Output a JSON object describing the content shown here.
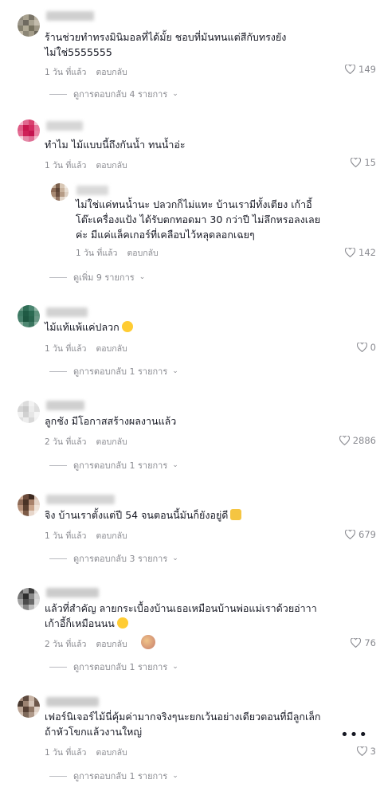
{
  "comments": [
    {
      "text": "ร้านช่วยทำทรงมินิมอลที่ได้มั้ย ชอบที่มันทนแต่สีกับทรงยัง\nไม่ใช่5555555",
      "time": "1 วัน ที่แล้ว",
      "reply_label": "ตอบกลับ",
      "likes": "149",
      "view_replies": "ดูการตอบกลับ 4 รายการ"
    },
    {
      "text": "ทำไม ไม้แบบนี้ถึงกันน้ำ ทนน้ำอ่ะ",
      "time": "1 วัน ที่แล้ว",
      "reply_label": "ตอบกลับ",
      "likes": "15",
      "reply": {
        "text": "ไม่ใช่แค่ทนน้ำนะ ปลวกก็ไม่แทะ บ้านเรามีทั้งเตียง เก้าอี้\nโต๊ะเครื่องแป้ง ได้รับตกทอดมา 30 กว่าปี ไม่ลึกหรอลงเลย\nค่ะ มีแค่แล็คเกอร์ที่เคลือบไว้หลุดลอกเฉยๆ",
        "time": "1 วัน ที่แล้ว",
        "reply_label": "ตอบกลับ",
        "likes": "142"
      },
      "view_replies": "ดูเพิ่ม 9 รายการ"
    },
    {
      "text": "ไม้แท้แพ้แค่ปลวก",
      "time": "1 วัน ที่แล้ว",
      "reply_label": "ตอบกลับ",
      "likes": "0",
      "view_replies": "ดูการตอบกลับ 1 รายการ"
    },
    {
      "text": "ลูกชัง มีโอกาสสร้างผลงานแล้ว",
      "time": "2 วัน ที่แล้ว",
      "reply_label": "ตอบกลับ",
      "likes": "2886",
      "view_replies": "ดูการตอบกลับ 1 รายการ"
    },
    {
      "text": "จิง บ้านเราตั้งแต่ปี 54 จนตอนนี้มันก็ยังอยู่ดี",
      "time": "1 วัน ที่แล้ว",
      "reply_label": "ตอบกลับ",
      "likes": "679",
      "view_replies": "ดูการตอบกลับ 3 รายการ"
    },
    {
      "text": "แล้วที่สำคัญ ลายกระเบื้องบ้านเธอเหมือนบ้านพ่อแม่เราด้วยอ่าาา\nเก้าอี้ก็เหมือนนน",
      "time": "2 วัน ที่แล้ว",
      "reply_label": "ตอบกลับ",
      "likes": "76",
      "view_replies": "ดูการตอบกลับ 1 รายการ"
    },
    {
      "text": "เฟอร์นิเจอร์ไม้นี่คุ้มค่ามากจริงๆนะยกเว้นอย่างเดียวตอนที่มีลูกเล็ก\nถ้าหัวโขกแล้วงานใหญ่",
      "time": "1 วัน ที่แล้ว",
      "reply_label": "ตอบกลับ",
      "likes": "3",
      "more": "•••",
      "view_replies": "ดูการตอบกลับ 1 รายการ"
    }
  ],
  "colors": {
    "text": "#161823",
    "secondary": "#8a8b91",
    "background": "#ffffff"
  }
}
